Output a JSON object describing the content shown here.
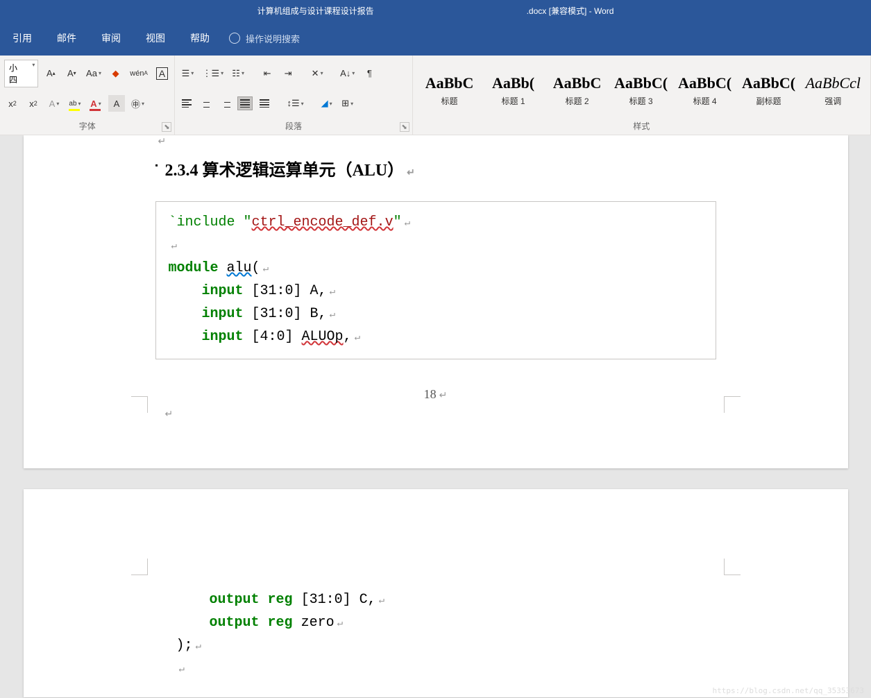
{
  "title": {
    "docname": "计算机组成与设计课程设计报告",
    "suffix": ".docx [兼容模式]  -  Word"
  },
  "menu": {
    "tabs": [
      "引用",
      "邮件",
      "审阅",
      "视图",
      "帮助"
    ],
    "tellme": "操作说明搜索"
  },
  "ribbon": {
    "font_size": "小四",
    "group_font": "字体",
    "group_para": "段落",
    "group_styles": "样式"
  },
  "styles": [
    {
      "preview": "AaBbC",
      "name": "标题"
    },
    {
      "preview": "AaBb(",
      "name": "标题 1"
    },
    {
      "preview": "AaBbC",
      "name": "标题 2"
    },
    {
      "preview": "AaBbC(",
      "name": "标题 3"
    },
    {
      "preview": "AaBbC(",
      "name": "标题 4"
    },
    {
      "preview": "AaBbC(",
      "name": "副标题"
    },
    {
      "preview": "AaBbCcl",
      "name": "强调",
      "italic": true
    }
  ],
  "doc": {
    "heading": "2.3.4 算术逻辑运算单元（ALU）",
    "code1": {
      "include_pre": "`include \"",
      "include_file": "ctrl_encode_def.v",
      "include_post": "\"",
      "module_kw": "module",
      "module_name": "alu",
      "module_paren": "(",
      "l1_kw": "input",
      "l1_rest": " [31:0] A,",
      "l2_kw": "input",
      "l2_rest": " [31:0] B,",
      "l3_kw": "input",
      "l3_mid": " [4:0] ",
      "l3_name": "ALUOp",
      "l3_end": ","
    },
    "pagenum": "18",
    "code2": {
      "l1_kw": "output",
      "l1_reg": "reg",
      "l1_rest": " [31:0] C,",
      "l2_kw": "output",
      "l2_reg": "reg",
      "l2_rest": " zero",
      "l3": ");"
    }
  },
  "watermark": "https://blog.csdn.net/qq_35353673"
}
